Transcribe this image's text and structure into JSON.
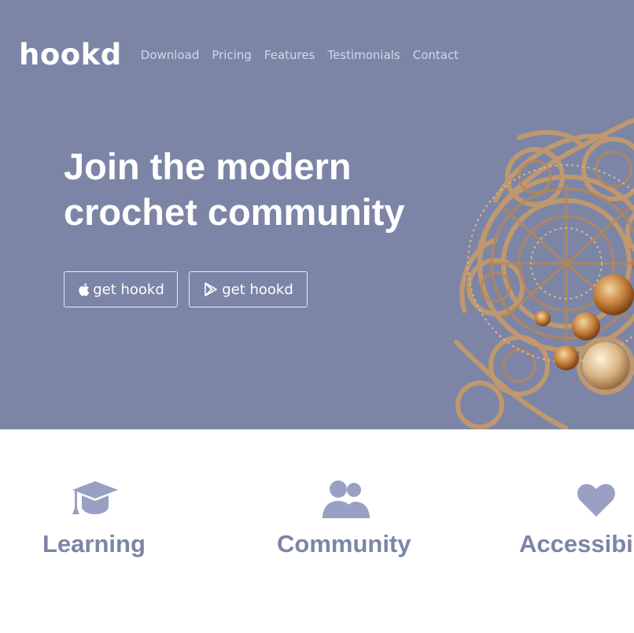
{
  "header": {
    "brand": "hookd",
    "nav": [
      "Download",
      "Pricing",
      "Features",
      "Testimonials",
      "Contact"
    ]
  },
  "hero": {
    "headline_line1": "Join the modern",
    "headline_line2": "crochet community",
    "buttons": [
      {
        "label": "get hookd",
        "icon": "apple-icon"
      },
      {
        "label": "get hookd",
        "icon": "google-play-icon"
      }
    ],
    "image": "crochet-doily-image"
  },
  "features": [
    {
      "title": "Learning",
      "icon": "graduation-cap-icon"
    },
    {
      "title": "Community",
      "icon": "users-icon"
    },
    {
      "title": "Accessibi",
      "icon": "heart-icon"
    }
  ],
  "colors": {
    "hero_background": "#7c85a6",
    "accent": "#7c85a6",
    "icon_color": "#9aa0c4",
    "text_light": "#ffffff"
  }
}
